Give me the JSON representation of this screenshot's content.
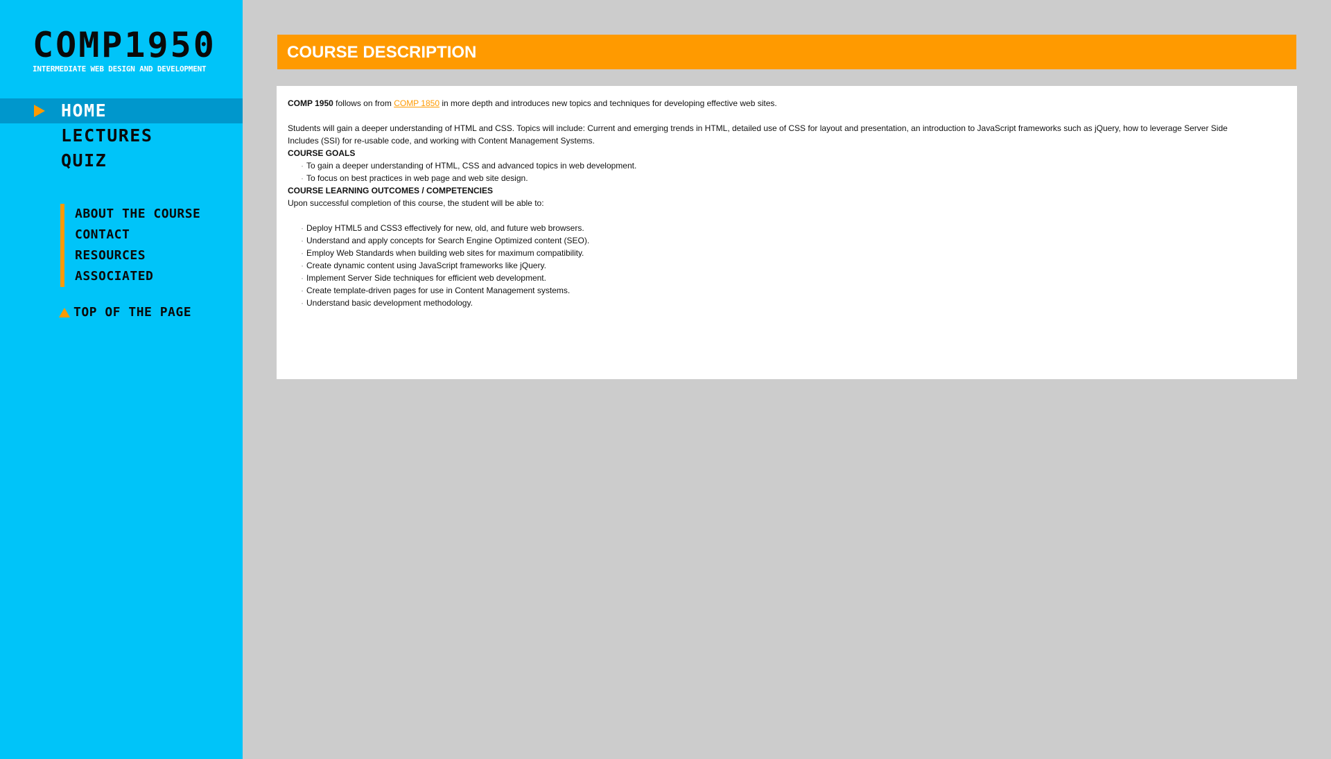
{
  "logo": {
    "title": "COMP1950",
    "subtitle": "INTERMEDIATE WEB DESIGN AND DEVELOPMENT"
  },
  "main_nav": [
    {
      "label": "HOME",
      "active": true
    },
    {
      "label": "LECTURES",
      "active": false
    },
    {
      "label": "QUIZ",
      "active": false
    }
  ],
  "sub_nav": [
    {
      "label": "ABOUT THE COURSE"
    },
    {
      "label": "CONTACT"
    },
    {
      "label": "RESOURCES"
    },
    {
      "label": "ASSOCIATED"
    }
  ],
  "top_link": {
    "label": "TOP OF THE PAGE"
  },
  "header": {
    "title": "COURSE DESCRIPTION"
  },
  "content": {
    "intro": {
      "course_code": "COMP 1950",
      "text_before_link": " follows on from ",
      "link_text": "COMP 1850",
      "text_after_link": " in more depth and introduces new topics and techniques for developing effective web sites."
    },
    "paragraph2": "Students will gain a deeper understanding of HTML and CSS. Topics will include: Current and emerging trends in HTML, detailed use of CSS for layout and presentation, an introduction to JavaScript frameworks such as jQuery, how to leverage Server Side Includes (SSI) for re-usable code, and working with Content Management Systems.",
    "goals_heading": "COURSE GOALS",
    "goals": [
      "To gain a deeper understanding of HTML, CSS and advanced topics in web development.",
      "To focus on best practices in web page and web site design."
    ],
    "outcomes_heading": "COURSE LEARNING OUTCOMES / COMPETENCIES",
    "outcomes_intro": "Upon successful completion of this course, the student will be able to:",
    "outcomes": [
      "Deploy HTML5 and CSS3 effectively for new, old, and future web browsers.",
      "Understand and apply concepts for Search Engine Optimized content (SEO).",
      "Employ Web Standards when building web sites for maximum compatibility.",
      "Create dynamic content using JavaScript frameworks like jQuery.",
      "Implement Server Side techniques for efficient web development.",
      "Create template-driven pages for use in Content Management systems.",
      "Understand basic development methodology."
    ],
    "bullet_glyph": "·"
  },
  "colors": {
    "sidebar": "#00c4f9",
    "active_nav": "#0097cc",
    "accent": "#ff9a00",
    "page_bg": "#cccccc"
  }
}
